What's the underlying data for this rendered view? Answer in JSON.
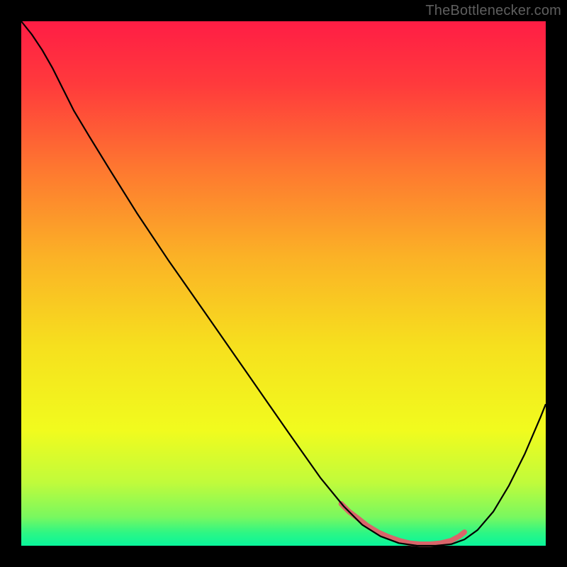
{
  "watermark": "TheBottlenecker.com",
  "chart_data": {
    "type": "line",
    "title": "",
    "xlabel": "",
    "ylabel": "",
    "xlim": [
      0,
      100
    ],
    "ylim": [
      0,
      100
    ],
    "gradient_stops": [
      {
        "offset": 0.0,
        "color": "#ff1d45"
      },
      {
        "offset": 0.12,
        "color": "#ff3a3c"
      },
      {
        "offset": 0.28,
        "color": "#fe7730"
      },
      {
        "offset": 0.45,
        "color": "#fbb226"
      },
      {
        "offset": 0.62,
        "color": "#f6e01e"
      },
      {
        "offset": 0.78,
        "color": "#f1fb1e"
      },
      {
        "offset": 0.88,
        "color": "#c0fb3b"
      },
      {
        "offset": 0.945,
        "color": "#79f85f"
      },
      {
        "offset": 0.975,
        "color": "#2ef684"
      },
      {
        "offset": 1.0,
        "color": "#09f59b"
      }
    ],
    "series": [
      {
        "name": "curve",
        "color": "#000000",
        "stroke_width": 2.2,
        "x": [
          0.0,
          2.0,
          4.0,
          6.0,
          8.0,
          10.0,
          13.0,
          17.0,
          22.0,
          28.0,
          35.0,
          43.0,
          51.0,
          57.0,
          61.5,
          65.0,
          68.5,
          72.0,
          75.5,
          79.0,
          82.0,
          84.5,
          87.0,
          90.0,
          93.0,
          96.0,
          99.0,
          100.0
        ],
        "y": [
          100.0,
          97.5,
          94.5,
          91.0,
          87.0,
          83.0,
          78.0,
          71.5,
          63.5,
          54.5,
          44.5,
          33.0,
          21.5,
          13.0,
          7.5,
          4.0,
          1.8,
          0.5,
          0.0,
          0.0,
          0.3,
          1.2,
          3.0,
          6.5,
          11.5,
          17.5,
          24.5,
          27.0
        ]
      },
      {
        "name": "highlight-band",
        "color": "#d9656a",
        "stroke_width": 7.5,
        "linecap": "round",
        "x": [
          61.0,
          62.5,
          64.5,
          66.0,
          68.0,
          70.0,
          72.0,
          74.0,
          76.0,
          78.0,
          80.0,
          82.0,
          83.5,
          84.5
        ],
        "y": [
          8.0,
          6.5,
          5.0,
          3.8,
          2.6,
          1.7,
          1.0,
          0.5,
          0.3,
          0.3,
          0.5,
          1.0,
          1.8,
          2.6
        ]
      }
    ]
  }
}
